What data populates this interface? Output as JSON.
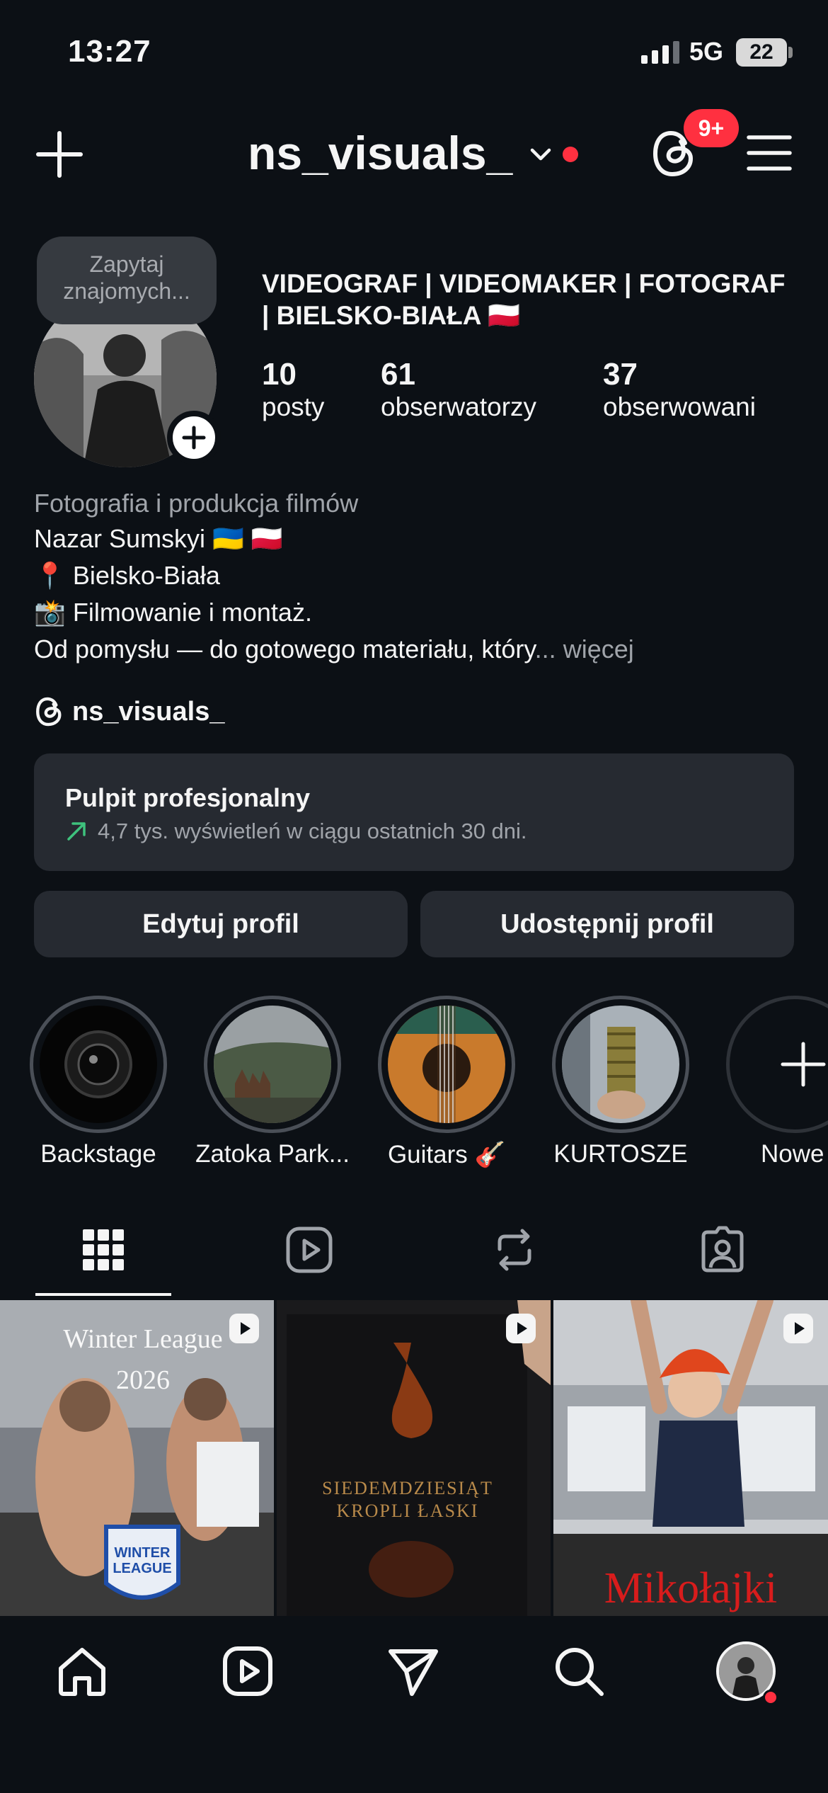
{
  "status_bar": {
    "time": "13:27",
    "network": "5G",
    "battery": "22"
  },
  "header": {
    "username": "ns_visuals_",
    "notification_badge": "9+"
  },
  "profile": {
    "note": "Zapytaj znajomych...",
    "full_name": "VIDEOGRAF | VIDEOMAKER | FOTOGRAF | BIELSKO-BIAŁA 🇵🇱",
    "stats": [
      {
        "value": "10",
        "label": "posty"
      },
      {
        "value": "61",
        "label": "obserwatorzy"
      },
      {
        "value": "37",
        "label": "obserwowani"
      }
    ],
    "category": "Fotografia i produkcja filmów",
    "bio": [
      "Nazar Sumskyi 🇺🇦 🇵🇱",
      "📍 Bielsko-Biała",
      "📸 Filmowanie i montaż.",
      "Od pomysłu — do gotowego materiału, który"
    ],
    "bio_ellipsis": "...",
    "bio_more": "więcej",
    "threads_handle": "ns_visuals_"
  },
  "dashboard": {
    "title": "Pulpit profesjonalny",
    "subtitle": "4,7 tys. wyświetleń w ciągu ostatnich 30 dni."
  },
  "buttons": {
    "edit": "Edytuj profil",
    "share": "Udostępnij profil"
  },
  "highlights": [
    {
      "label": "Backstage"
    },
    {
      "label": "Zatoka Park..."
    },
    {
      "label": "Guitars 🎸"
    },
    {
      "label": "KURTOSZE"
    },
    {
      "label": "Nowe"
    }
  ],
  "posts": [
    {
      "title_lines": [
        "Winter League",
        "2026"
      ],
      "badge": "WINTER LEAGUE"
    },
    {
      "title_lines": [
        "SIEDEMDZIESIĄT",
        "KROPLI ŁASKI"
      ]
    },
    {
      "caption": "Mikołajki"
    }
  ],
  "colors": {
    "accent_red": "#ff3040",
    "surface": "#262a31",
    "background": "#0c1015",
    "trend_green": "#3ec27d"
  }
}
